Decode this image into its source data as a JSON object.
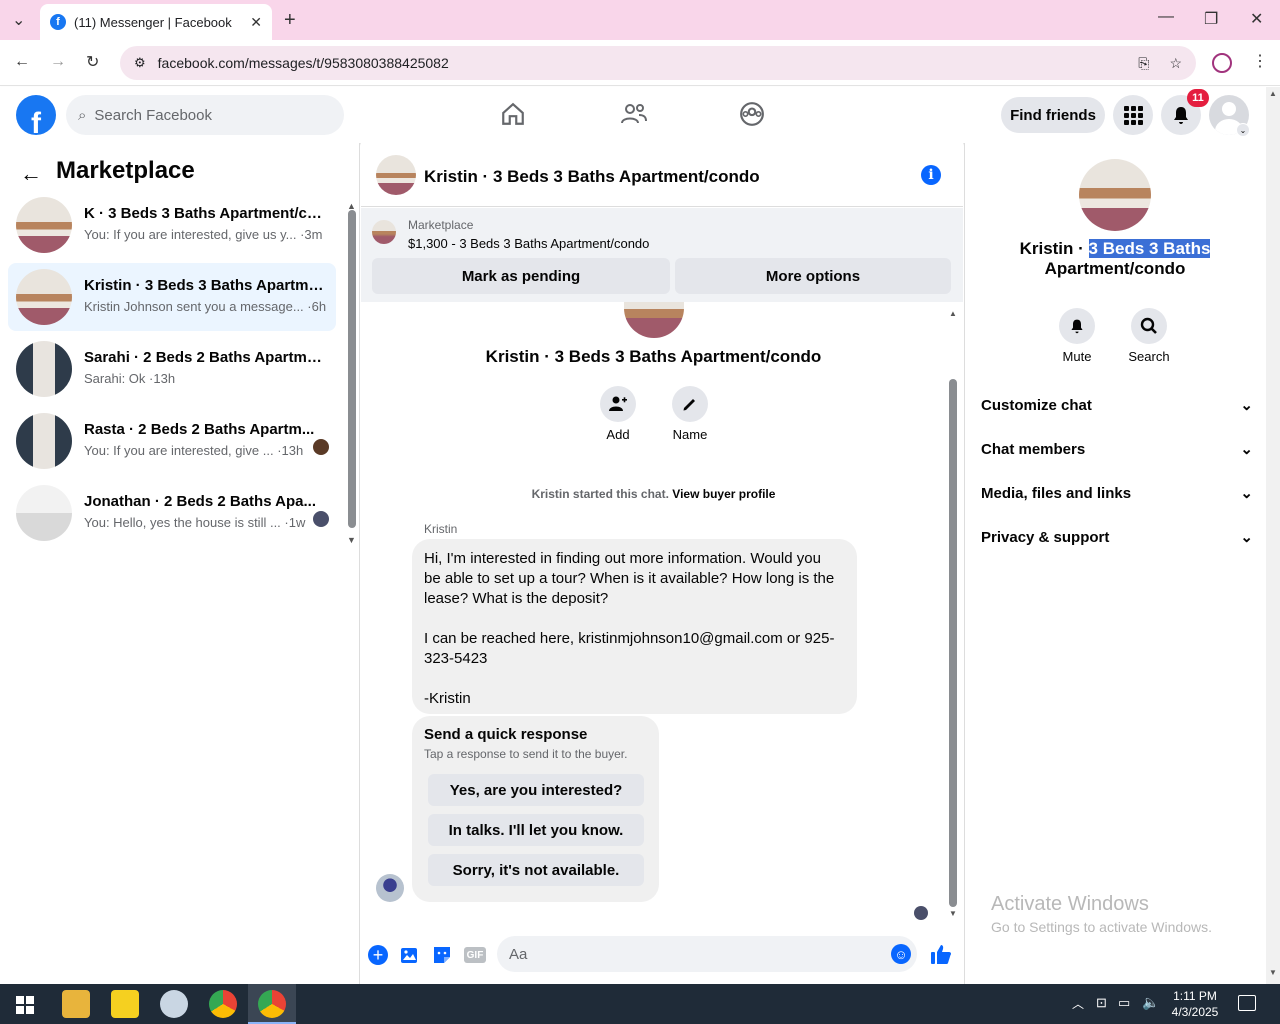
{
  "browser": {
    "tab_title": "(11) Messenger | Facebook",
    "url": "facebook.com/messages/t/9583080388425082"
  },
  "header": {
    "search_placeholder": "Search Facebook",
    "find_friends": "Find friends",
    "notification_count": "11"
  },
  "left": {
    "title": "Marketplace",
    "conversations": [
      {
        "name": "K · 3 Beds 3 Baths Apartment/co...",
        "preview": "You: If you are interested, give us y... ·3m"
      },
      {
        "name": "Kristin · 3 Beds 3 Baths Apartme...",
        "preview": "Kristin Johnson sent you a message... ·6h"
      },
      {
        "name": "Sarahi · 2 Beds 2 Baths Apartme...",
        "preview": "Sarahi: Ok ·13h"
      },
      {
        "name": "Rasta · 2 Beds 2 Baths Apartm...",
        "preview": "You: If you are interested, give ... ·13h"
      },
      {
        "name": "Jonathan · 2 Beds 2 Baths Apa...",
        "preview": "You: Hello, yes the house is still ... ·1w"
      }
    ]
  },
  "chat": {
    "title": "Kristin · 3 Beds 3 Baths Apartment/condo",
    "marketplace_label": "Marketplace",
    "listing": "$1,300 - 3 Beds 3 Baths Apartment/condo",
    "mark_pending": "Mark as pending",
    "more_options": "More options",
    "profile_name": "Kristin · 3 Beds 3 Baths Apartment/condo",
    "add_label": "Add",
    "name_label": "Name",
    "started_text": "Kristin started this chat.",
    "view_buyer": "View buyer profile",
    "sender": "Kristin",
    "message_lines": [
      "Hi, I'm interested in finding out more information. Would you",
      "be able to set up a tour? When is it available? How  long is the",
      "lease? What is the deposit?",
      "",
      "I can be reached here, kristinmjohnson10@gmail.com or 925-",
      "323-5423",
      "",
      "-Kristin"
    ],
    "quick_title": "Send a quick response",
    "quick_sub": "Tap a response to send it to the buyer.",
    "quick_responses": [
      "Yes, are you interested?",
      "In talks. I'll let you know.",
      "Sorry, it's not available."
    ],
    "composer_placeholder": "Aa",
    "gif_label": "GIF"
  },
  "right": {
    "name_prefix": "Kristin · ",
    "name_highlight": "3 Beds 3 Baths",
    "name_line2": "Apartment/condo",
    "mute": "Mute",
    "search": "Search",
    "sections": [
      "Customize chat",
      "Chat members",
      "Media, files and links",
      "Privacy & support"
    ]
  },
  "watermark": {
    "line1": "Activate Windows",
    "line2": "Go to Settings to activate Windows."
  },
  "taskbar": {
    "time": "1:11 PM",
    "date": "4/3/2025"
  }
}
